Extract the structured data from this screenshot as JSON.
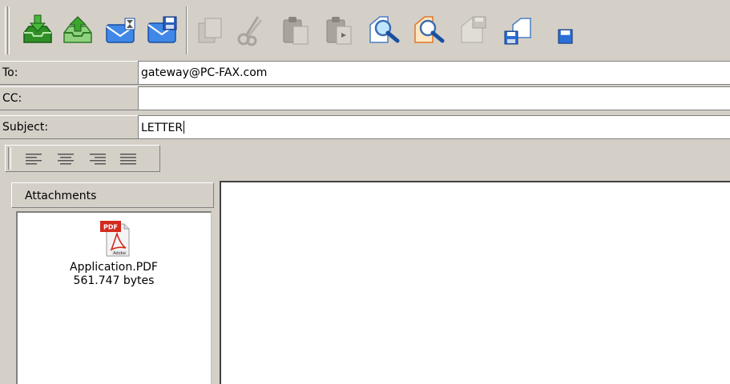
{
  "toolbar": {
    "buttons": [
      {
        "name": "receive-icon",
        "enabled": true
      },
      {
        "name": "send-icon",
        "enabled": true
      },
      {
        "name": "send-later-icon",
        "enabled": true
      },
      {
        "name": "save-message-icon",
        "enabled": true
      },
      {
        "name": "copy-icon",
        "enabled": false
      },
      {
        "name": "cut-icon",
        "enabled": false
      },
      {
        "name": "paste-icon",
        "enabled": false
      },
      {
        "name": "paste-special-icon",
        "enabled": false
      },
      {
        "name": "find-icon",
        "enabled": true
      },
      {
        "name": "find-next-icon",
        "enabled": true
      },
      {
        "name": "save-disabled-icon",
        "enabled": false
      },
      {
        "name": "save-as-icon",
        "enabled": true
      },
      {
        "name": "save-partial-icon",
        "enabled": true
      }
    ]
  },
  "fields": {
    "to_label": "To:",
    "to_value": "gateway@PC-FAX.com",
    "cc_label": "CC:",
    "cc_value": "",
    "subject_label": "Subject:",
    "subject_value": "LETTER"
  },
  "format_bar": {
    "buttons": [
      "align-left-icon",
      "align-center-icon",
      "align-right-icon",
      "justify-icon"
    ]
  },
  "attachments": {
    "header": "Attachments",
    "items": [
      {
        "icon": "pdf-file-icon",
        "icon_text": "PDF",
        "brand_text": "Adobe",
        "name": "Application.PDF",
        "size": "561.747 bytes"
      }
    ]
  },
  "colors": {
    "window_bg": "#d4d0c8",
    "green_accent": "#3aa62c",
    "blue_accent": "#2a6fd6",
    "pdf_red": "#d42a1e"
  }
}
